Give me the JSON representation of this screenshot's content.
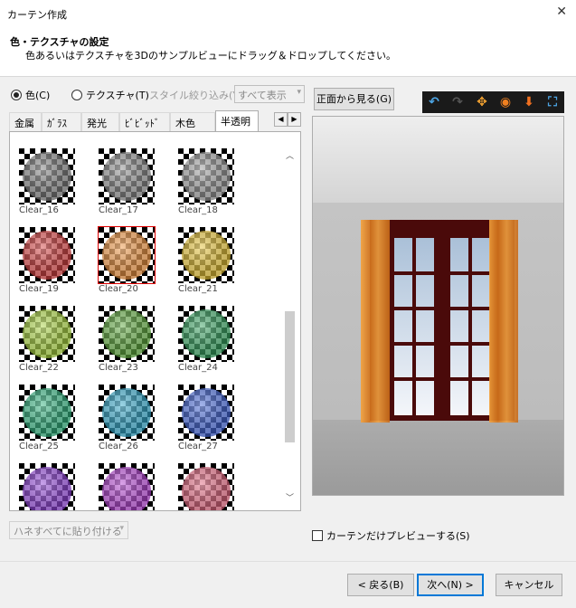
{
  "window": {
    "title": "カーテン作成",
    "close_label": "✕"
  },
  "header": {
    "title": "色・テクスチャの設定",
    "description": "色あるいはテクスチャを3Dのサンプルビューにドラッグ＆ドロップしてください。"
  },
  "mode": {
    "color_label": "色(C)",
    "texture_label": "テクスチャ(T)",
    "selected": "color"
  },
  "style_filter": {
    "label": "スタイル絞り込み(Y):",
    "value": "すべて表示"
  },
  "front_view_button": "正面から見る(G)",
  "tabs": [
    {
      "label": "金属"
    },
    {
      "label": "ｶﾞﾗｽ"
    },
    {
      "label": "発光"
    },
    {
      "label": "ﾋﾞﾋﾞｯﾄﾞ"
    },
    {
      "label": "木色"
    },
    {
      "label": "半透明",
      "active": true
    }
  ],
  "swatches": [
    {
      "label": "Clear_16",
      "color": "#7a7a7a"
    },
    {
      "label": "Clear_17",
      "color": "#8a8a8a"
    },
    {
      "label": "Clear_18",
      "color": "#9a9a9a"
    },
    {
      "label": "Clear_19",
      "color": "#d63a3a"
    },
    {
      "label": "Clear_20",
      "color": "#f0913a",
      "selected": true
    },
    {
      "label": "Clear_21",
      "color": "#e6c02e"
    },
    {
      "label": "Clear_22",
      "color": "#a8d43a"
    },
    {
      "label": "Clear_23",
      "color": "#5aa838"
    },
    {
      "label": "Clear_24",
      "color": "#2fa05a"
    },
    {
      "label": "Clear_25",
      "color": "#2ab07a"
    },
    {
      "label": "Clear_26",
      "color": "#2aa3c8"
    },
    {
      "label": "Clear_27",
      "color": "#3c5fd6"
    },
    {
      "label": "",
      "color": "#8a3ad6"
    },
    {
      "label": "",
      "color": "#b03ad0"
    },
    {
      "label": "",
      "color": "#e0607a"
    }
  ],
  "paste_all": {
    "label": "ハネすべてに貼り付ける"
  },
  "toolbar_icons": [
    "undo-icon",
    "redo-icon",
    "move-icon",
    "rotate-icon",
    "down-arrow-icon",
    "fit-view-icon"
  ],
  "preview_only": {
    "label": "カーテンだけプレビューする(S)",
    "checked": false
  },
  "buttons": {
    "back": "< 戻る(B)",
    "next": "次へ(N) >",
    "cancel": "キャンセル"
  },
  "colors": {
    "accent": "#0078d7",
    "selection": "#e00000"
  }
}
